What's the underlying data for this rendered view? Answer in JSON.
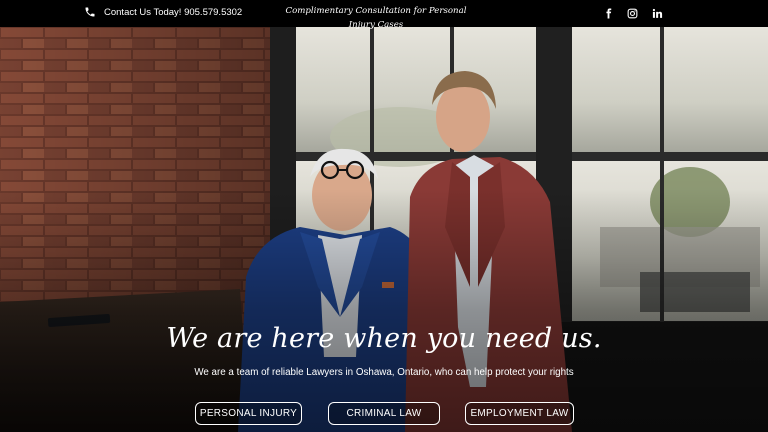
{
  "topbar": {
    "phone_icon": "phone-icon",
    "phone_text": "Contact Us Today! 905.579.5302",
    "tagline": "Complimentary Consultation for Personal Injury Cases",
    "social": [
      "facebook-icon",
      "instagram-icon",
      "linkedin-icon"
    ]
  },
  "hero": {
    "headline": "We are here when you need us.",
    "subheadline": "We are a team of reliable Lawyers in Oshawa, Ontario, who can help protect your rights",
    "buttons": [
      {
        "label": "PERSONAL INJURY"
      },
      {
        "label": "CRIMINAL LAW"
      },
      {
        "label": "EMPLOYMENT LAW"
      }
    ]
  },
  "colors": {
    "topbar_bg": "#000000",
    "text": "#ffffff",
    "brick": "#8a4a3a",
    "window_frame": "#1e1e1e",
    "blue_jacket": "#1d3f86",
    "red_jacket": "#8a3a36"
  }
}
